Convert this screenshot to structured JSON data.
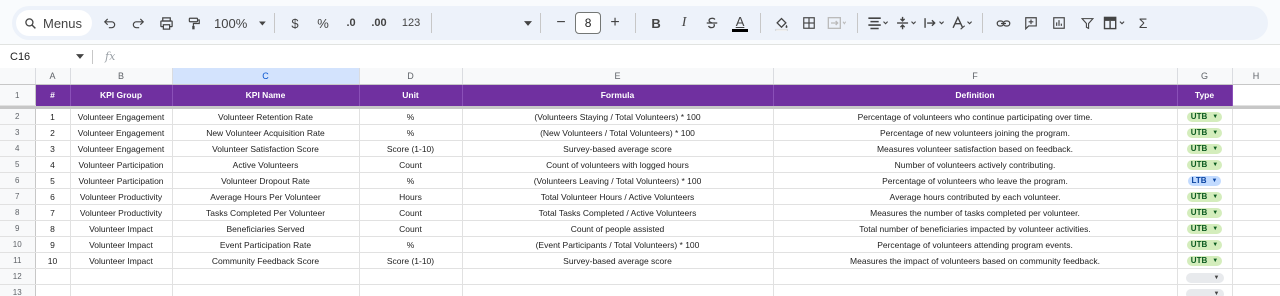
{
  "toolbar": {
    "menus_label": "Menus",
    "zoom": "100%",
    "currency": "$",
    "percent": "%",
    "decimal_decrease": ".0",
    "decimal_increase": ".00",
    "number_format": "123",
    "font_size": "8",
    "minus": "−",
    "plus": "+",
    "bold": "B",
    "italic": "I",
    "text_color_letter": "A",
    "sigma": "Σ"
  },
  "formula_bar": {
    "cell_ref": "C16",
    "fx": "fx"
  },
  "columns": [
    "A",
    "B",
    "C",
    "D",
    "E",
    "F",
    "G",
    "H"
  ],
  "header_row": {
    "row_num": "1",
    "cells": [
      "#",
      "KPI Group",
      "KPI Name",
      "Unit",
      "Formula",
      "Definition",
      "Type"
    ]
  },
  "rows": [
    {
      "row_num": "2",
      "cells": [
        "1",
        "Volunteer Engagement",
        "Volunteer Retention Rate",
        "%",
        "(Volunteers Staying / Total Volunteers) * 100",
        "Percentage of volunteers who continue participating over time.",
        "UTB"
      ]
    },
    {
      "row_num": "3",
      "cells": [
        "2",
        "Volunteer Engagement",
        "New Volunteer Acquisition Rate",
        "%",
        "(New Volunteers / Total Volunteers) * 100",
        "Percentage of new volunteers joining the program.",
        "UTB"
      ]
    },
    {
      "row_num": "4",
      "cells": [
        "3",
        "Volunteer Engagement",
        "Volunteer Satisfaction Score",
        "Score (1-10)",
        "Survey-based average score",
        "Measures volunteer satisfaction based on feedback.",
        "UTB"
      ]
    },
    {
      "row_num": "5",
      "cells": [
        "4",
        "Volunteer Participation",
        "Active Volunteers",
        "Count",
        "Count of volunteers with logged hours",
        "Number of volunteers actively contributing.",
        "UTB"
      ]
    },
    {
      "row_num": "6",
      "cells": [
        "5",
        "Volunteer Participation",
        "Volunteer Dropout Rate",
        "%",
        "(Volunteers Leaving / Total Volunteers) * 100",
        "Percentage of volunteers who leave the program.",
        "LTB"
      ]
    },
    {
      "row_num": "7",
      "cells": [
        "6",
        "Volunteer Productivity",
        "Average Hours Per Volunteer",
        "Hours",
        "Total Volunteer Hours / Active Volunteers",
        "Average hours contributed by each volunteer.",
        "UTB"
      ]
    },
    {
      "row_num": "8",
      "cells": [
        "7",
        "Volunteer Productivity",
        "Tasks Completed Per Volunteer",
        "Count",
        "Total Tasks Completed / Active Volunteers",
        "Measures the number of tasks completed per volunteer.",
        "UTB"
      ]
    },
    {
      "row_num": "9",
      "cells": [
        "8",
        "Volunteer Impact",
        "Beneficiaries Served",
        "Count",
        "Count of people assisted",
        "Total number of beneficiaries impacted by volunteer activities.",
        "UTB"
      ]
    },
    {
      "row_num": "10",
      "cells": [
        "9",
        "Volunteer Impact",
        "Event Participation Rate",
        "%",
        "(Event Participants / Total Volunteers) * 100",
        "Percentage of volunteers attending program events.",
        "UTB"
      ]
    },
    {
      "row_num": "11",
      "cells": [
        "10",
        "Volunteer Impact",
        "Community Feedback Score",
        "Score (1-10)",
        "Survey-based average score",
        "Measures the impact of volunteers based on community feedback.",
        "UTB"
      ]
    }
  ],
  "empty_rows": [
    "12",
    "13"
  ],
  "colors": {
    "header_bg": "#7030a0",
    "chip_utb": "#d4edbc",
    "chip_ltb": "#c2dbff",
    "selected_column": "#d3e3fd"
  }
}
